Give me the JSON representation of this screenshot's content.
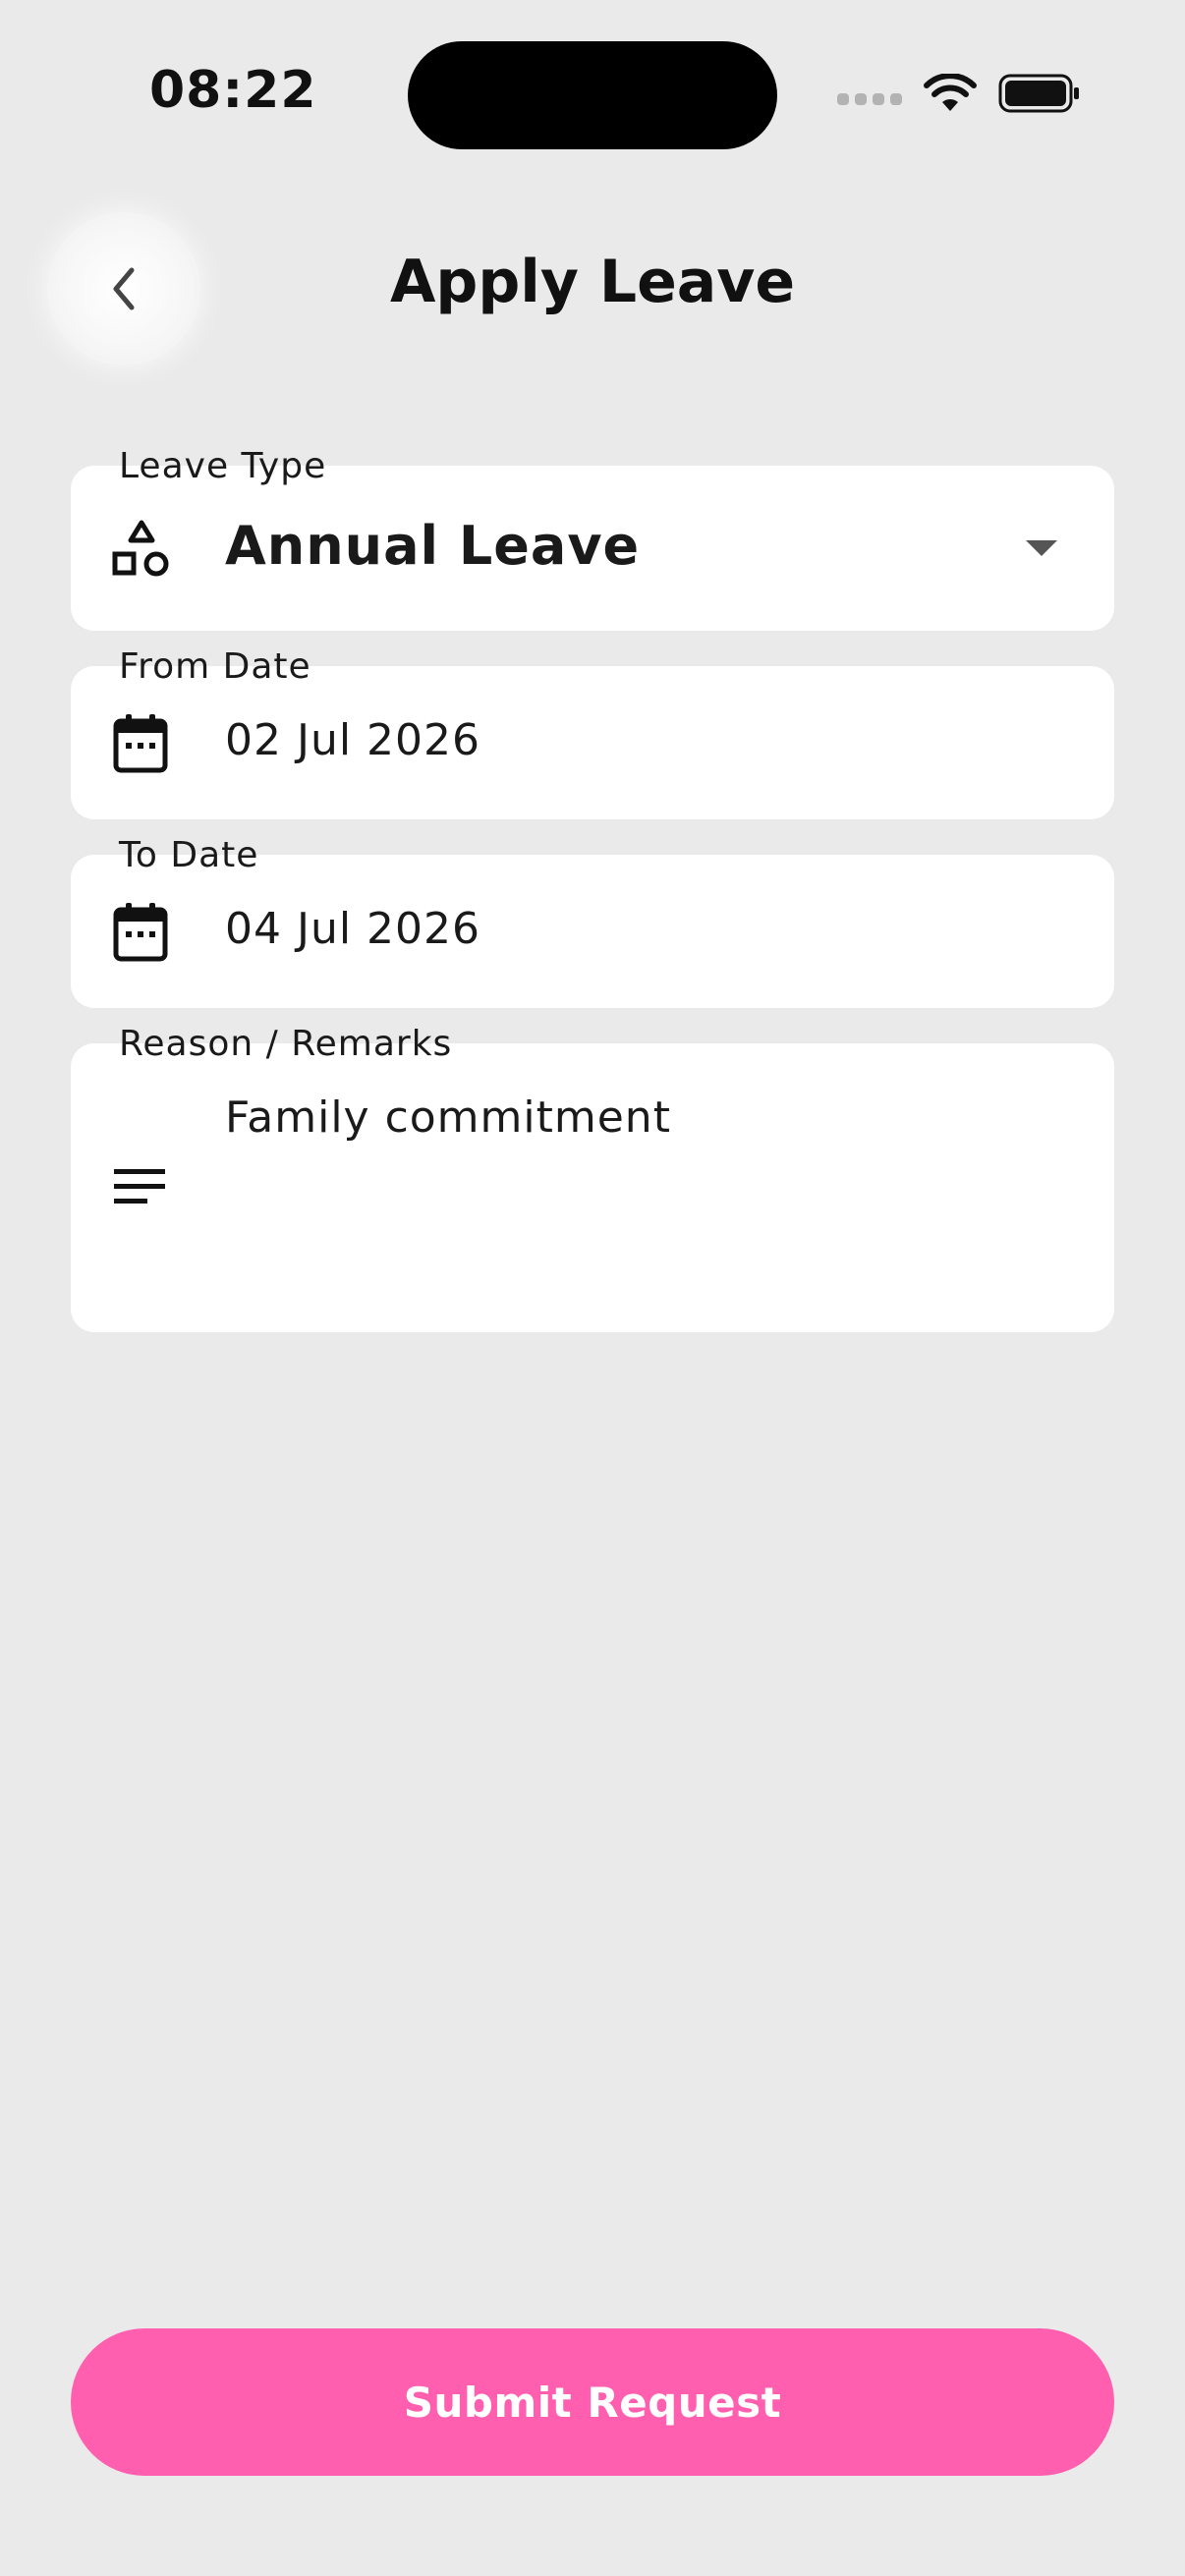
{
  "status_bar": {
    "time": "08:22"
  },
  "header": {
    "title": "Apply Leave",
    "back_icon": "chevron-left-icon"
  },
  "form": {
    "leave_type": {
      "label": "Leave Type",
      "value": "Annual Leave",
      "icon": "shapes-icon"
    },
    "from_date": {
      "label": "From Date",
      "value": "02 Jul 2026",
      "icon": "calendar-icon"
    },
    "to_date": {
      "label": "To Date",
      "value": "04 Jul 2026",
      "icon": "calendar-icon"
    },
    "reason": {
      "label": "Reason / Remarks",
      "value": "Family commitment",
      "icon": "notes-icon"
    }
  },
  "submit": {
    "label": "Submit Request"
  },
  "colors": {
    "background": "#eaeaea",
    "accent": "#ff5fae",
    "field_bg": "#ffffff"
  }
}
